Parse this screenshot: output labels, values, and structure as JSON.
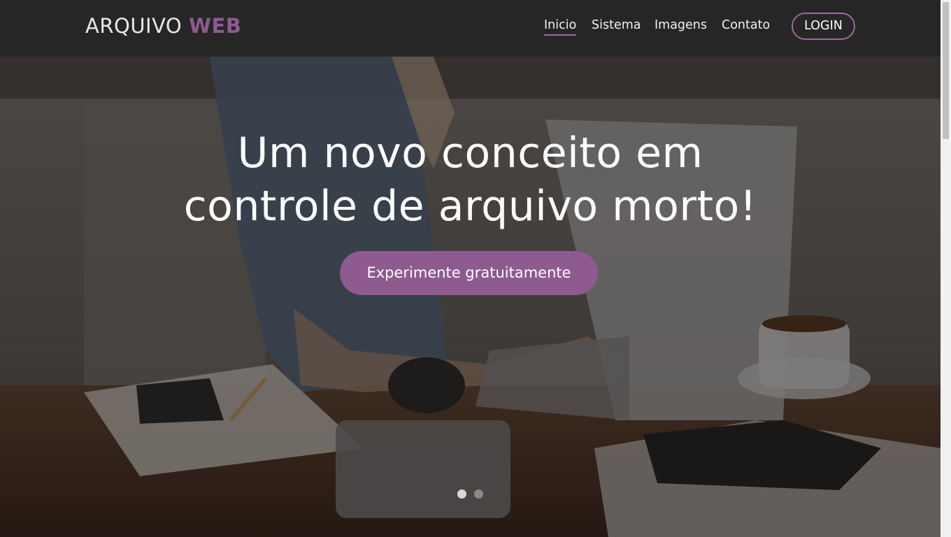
{
  "brand": {
    "light": "ARQUIVO ",
    "bold": "WEB"
  },
  "nav": {
    "items": [
      {
        "label": "Inicio",
        "active": true
      },
      {
        "label": "Sistema",
        "active": false
      },
      {
        "label": "Imagens",
        "active": false
      },
      {
        "label": "Contato",
        "active": false
      }
    ],
    "login_label": "LOGIN"
  },
  "hero": {
    "headline_line1": "Um novo conceito em",
    "headline_line2": "controle de arquivo morto!",
    "cta_label": "Experimente gratuitamente",
    "carousel": {
      "slides": 2,
      "active_index": 0
    }
  },
  "colors": {
    "accent": "#8e5a8f",
    "accent_border": "#a0679f",
    "navbar_bg": "#262626"
  }
}
